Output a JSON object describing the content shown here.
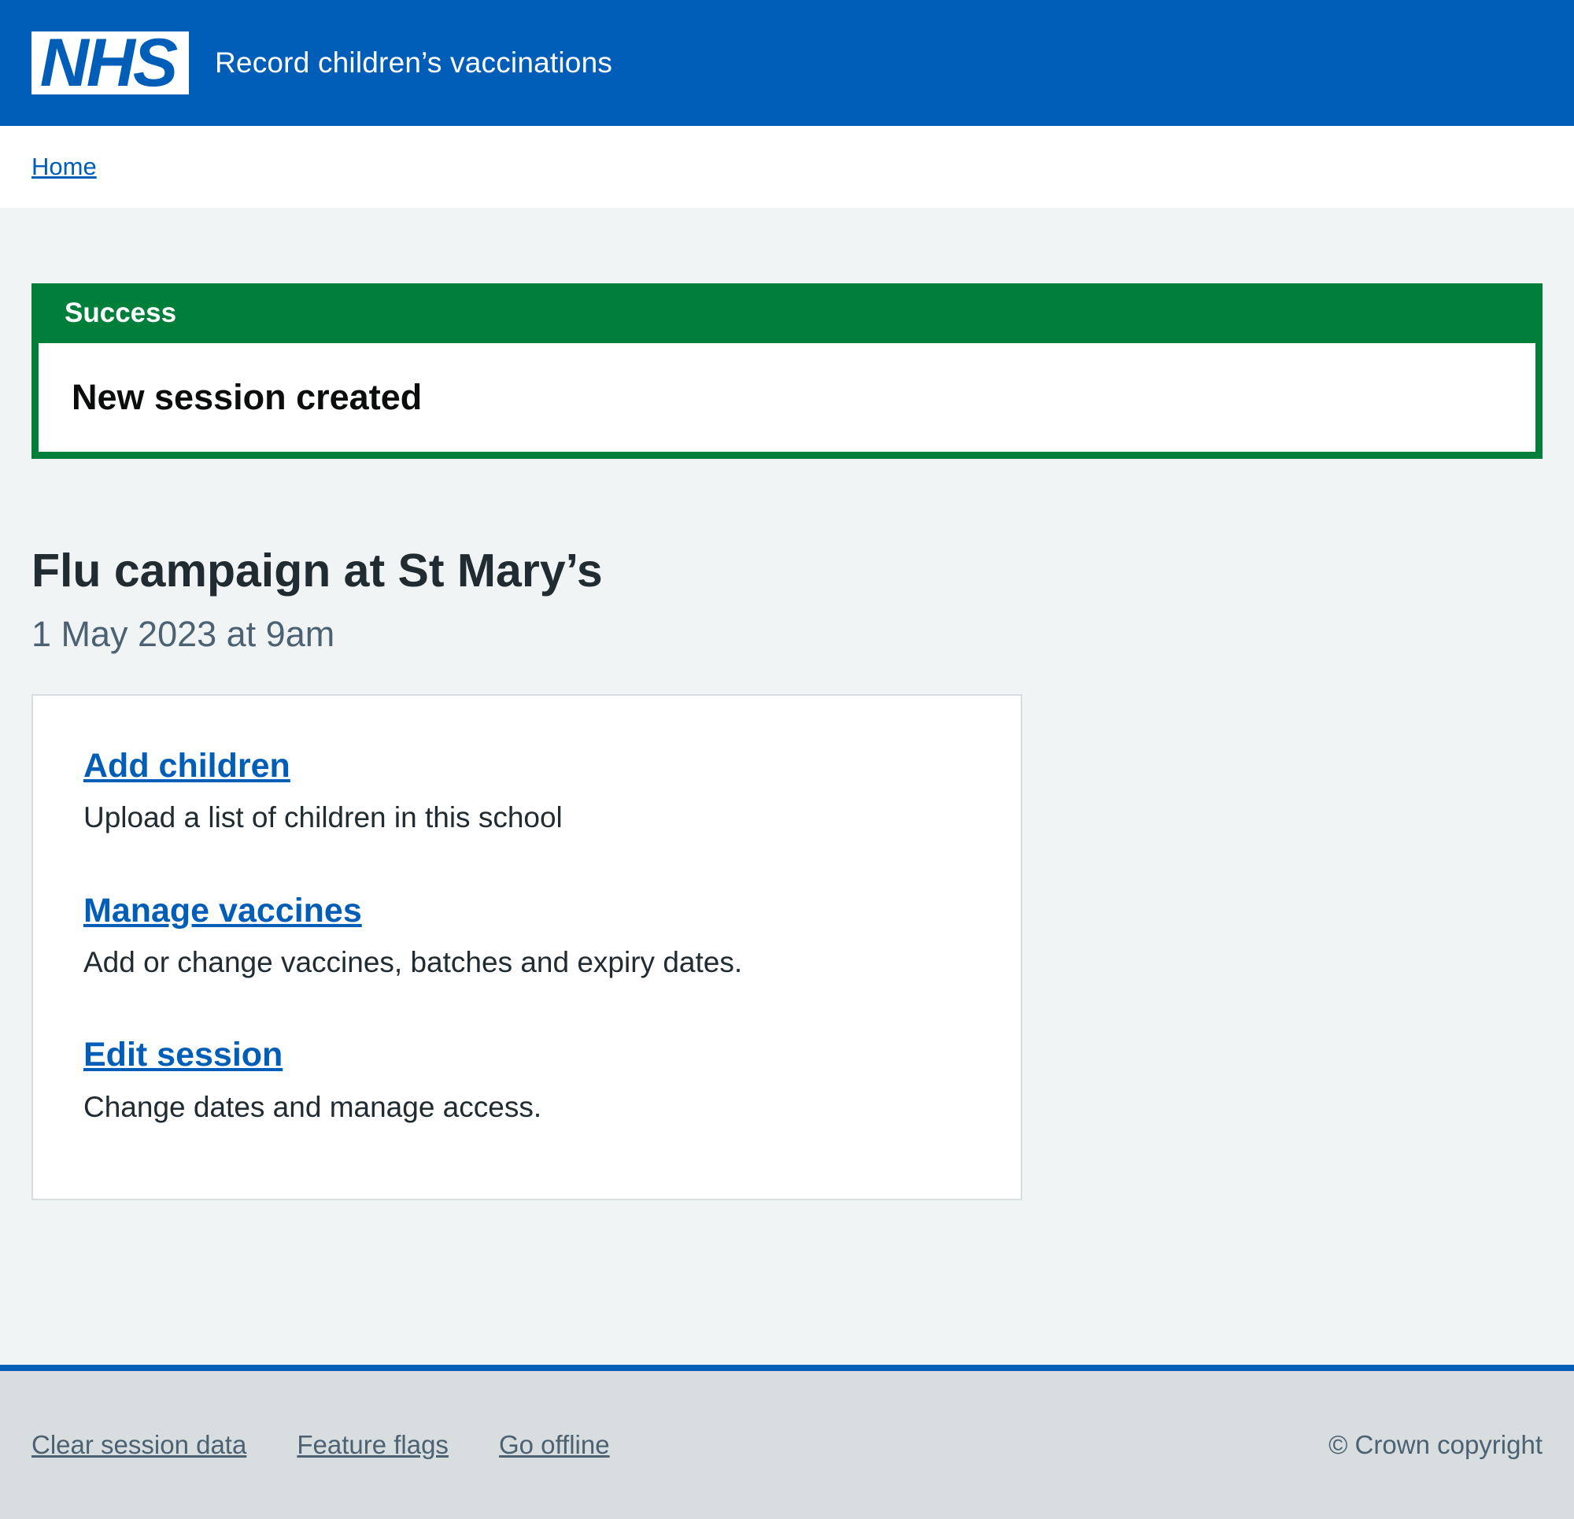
{
  "header": {
    "logo_text": "NHS",
    "service_name": "Record children’s vaccinations"
  },
  "breadcrumb": {
    "home_label": "Home"
  },
  "notification": {
    "title": "Success",
    "message": "New session created"
  },
  "page": {
    "title": "Flu campaign at St Mary’s",
    "subtitle": "1 May 2023 at 9am"
  },
  "actions": [
    {
      "label": "Add children",
      "description": "Upload a list of children in this school"
    },
    {
      "label": "Manage vaccines",
      "description": "Add or change vaccines, batches and expiry dates."
    },
    {
      "label": "Edit session",
      "description": "Change dates and manage access."
    }
  ],
  "footer": {
    "links": [
      "Clear session data",
      "Feature flags",
      "Go offline"
    ],
    "copyright": "© Crown copyright"
  },
  "colors": {
    "brand_blue": "#005eb8",
    "success_green": "#007f3b",
    "page_background": "#f0f4f5",
    "footer_background": "#d8dde0"
  }
}
